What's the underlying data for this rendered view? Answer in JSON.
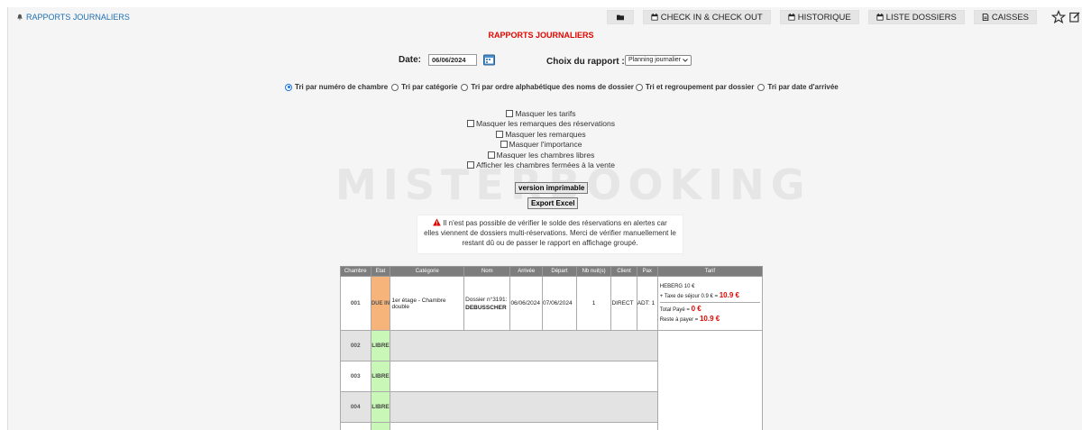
{
  "header": {
    "brand": "RAPPORTS JOURNALIERS",
    "nav": [
      {
        "label": "CHECK IN & CHECK OUT",
        "icon": "calendar-icon"
      },
      {
        "label": "HISTORIQUE",
        "icon": "calendar-icon"
      },
      {
        "label": "LISTE DOSSIERS",
        "icon": "calendar-icon"
      },
      {
        "label": "CAISSES",
        "icon": "document-icon"
      }
    ]
  },
  "page_title": "RAPPORTS JOURNALIERS",
  "form": {
    "date_label": "Date:",
    "date_value": "06/06/2024",
    "report_label": "Choix du rapport :",
    "report_value": "Planning journalier"
  },
  "sort_options": [
    {
      "label": "Tri par numéro de chambre",
      "selected": true
    },
    {
      "label": "Tri par catégorie",
      "selected": false
    },
    {
      "label": "Tri par ordre alphabétique des noms de dossier",
      "selected": false
    },
    {
      "label": "Tri et regroupement par dossier",
      "selected": false
    },
    {
      "label": "Tri par date d'arrivée",
      "selected": false
    }
  ],
  "checkbox_options": [
    "Masquer les tarifs",
    "Masquer les remarques des réservations",
    "Masquer les remarques",
    "Masquer l'importance",
    "Masquer les chambres libres",
    "Afficher les chambres fermées à la vente"
  ],
  "buttons": {
    "print": "version imprimable",
    "excel": "Export Excel"
  },
  "watermark": "MISTERBOOKING",
  "alert": {
    "line1": "Il n'est pas possible de vérifier le solde des réservations en alertes car",
    "line2": "elles viennent de dossiers multi-réservations. Merci de vérifier manuellement le",
    "line3": "restant dû ou de passer le rapport en affichage groupé."
  },
  "table": {
    "headers": [
      "Chambre",
      "Etat",
      "Catégorie",
      "Nom",
      "Arrivée",
      "Départ",
      "Nb nuit(s)",
      "Client",
      "Pax",
      "Tarif"
    ],
    "booking": {
      "room": "001",
      "state": "DUE IN",
      "category": "1er étage - Chambre double",
      "name_prefix": "Dossier n°3191:",
      "name": "DEBUSSCHER",
      "arrival": "06/06/2024",
      "departure": "07/06/2024",
      "nights": "1",
      "client": "DIRECT",
      "pax": "ADT: 1",
      "tarif_line1": "HEBERG 10 €",
      "tarif_line2": "+ Taxe de séjour 0.9 € =",
      "tarif_total": "10.9 €",
      "paid_label": "Total Payé =",
      "paid_value": "0 €",
      "rest_label": "Reste à payer =",
      "rest_value": "10.9 €"
    },
    "free_rooms": [
      {
        "room": "002",
        "state": "LIBRE"
      },
      {
        "room": "003",
        "state": "LIBRE"
      },
      {
        "room": "004",
        "state": "LIBRE"
      }
    ]
  }
}
